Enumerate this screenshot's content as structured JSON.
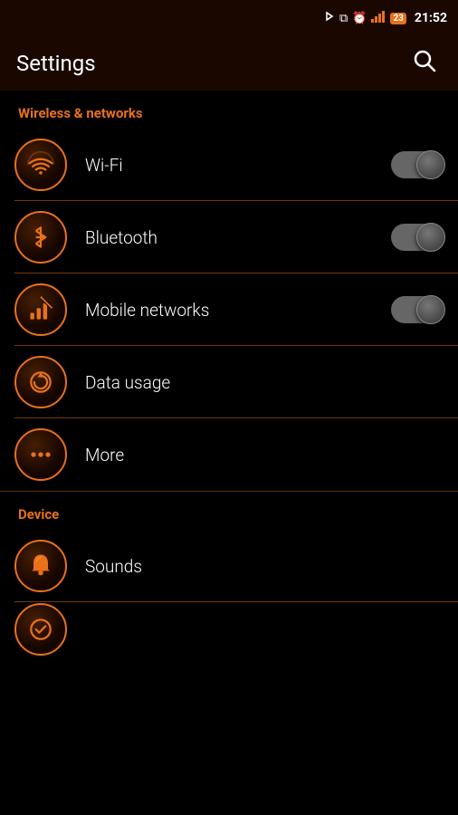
{
  "statusBar": {
    "time": "21:52",
    "batteryBadge": "23"
  },
  "appBar": {
    "title": "Settings",
    "searchLabel": "Search"
  },
  "sections": [
    {
      "id": "wireless",
      "label": "Wireless & networks",
      "items": [
        {
          "id": "wifi",
          "label": "Wi-Fi",
          "hasToggle": true,
          "toggleOn": true,
          "icon": "wifi"
        },
        {
          "id": "bluetooth",
          "label": "Bluetooth",
          "hasToggle": true,
          "toggleOn": true,
          "icon": "bluetooth"
        },
        {
          "id": "mobile",
          "label": "Mobile networks",
          "hasToggle": true,
          "toggleOn": true,
          "icon": "signal"
        },
        {
          "id": "datausage",
          "label": "Data usage",
          "hasToggle": false,
          "icon": "data"
        },
        {
          "id": "more",
          "label": "More",
          "hasToggle": false,
          "icon": "dots"
        }
      ]
    },
    {
      "id": "device",
      "label": "Device",
      "items": [
        {
          "id": "sounds",
          "label": "Sounds",
          "hasToggle": false,
          "icon": "bell"
        }
      ]
    }
  ]
}
